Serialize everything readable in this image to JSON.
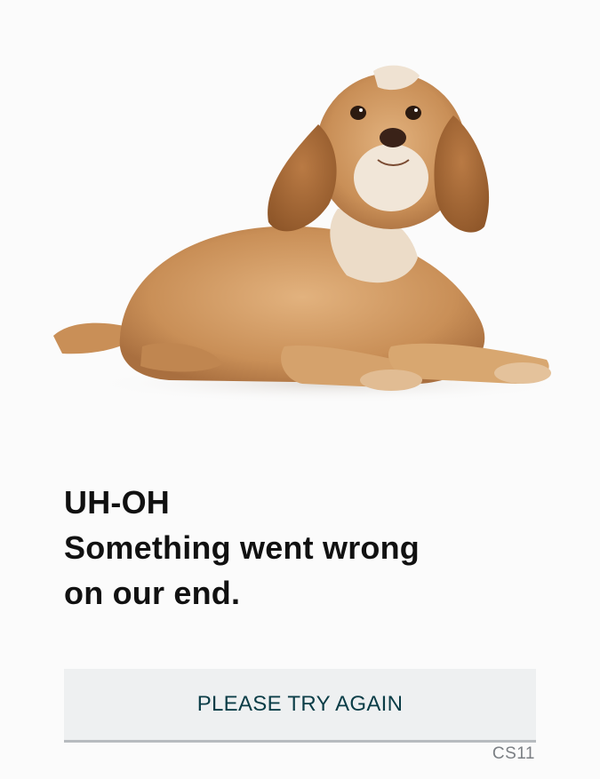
{
  "hero": {
    "image_name": "dog-photo"
  },
  "message": {
    "heading": "UH-OH",
    "line1": "Something went wrong",
    "line2": "on our end."
  },
  "retry_button": {
    "label": "PLEASE TRY AGAIN"
  },
  "error_code": "CS11",
  "colors": {
    "background": "#fbfbfb",
    "button_bg": "#eef0f1",
    "button_text": "#0b3d47",
    "code_text": "#7b7f84"
  }
}
